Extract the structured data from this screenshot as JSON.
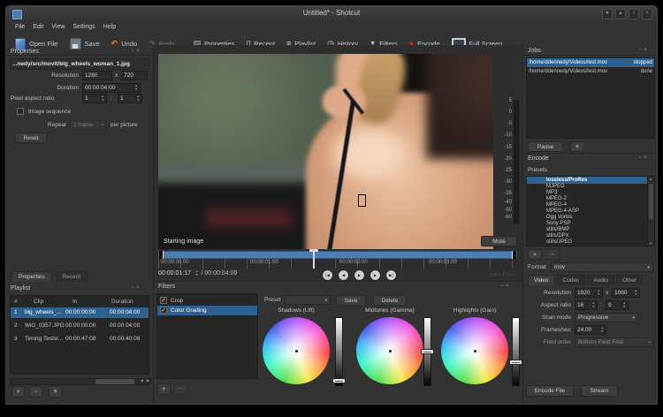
{
  "window": {
    "title": "Untitled* - Shotcut"
  },
  "icons": {
    "float": "▫",
    "close": "×",
    "spin_up": "▲",
    "spin_down": "▼",
    "combo": "▾",
    "check": "✓",
    "add": "+",
    "remove": "−",
    "menu": "≡",
    "undo": "↶",
    "redo": "↷",
    "record": "●",
    "history": "◷",
    "properties": "▤",
    "recent": "▯",
    "playlist": "≡",
    "funnel": "▼",
    "skip_back": "|◀",
    "step_back": "◀",
    "play": "▶",
    "step_fwd": "▶",
    "skip_fwd": "▶|",
    "left": "◀",
    "right": "▶",
    "up": "▲",
    "down": "▼",
    "win_shade": "▾",
    "win_min": "▴",
    "win_max": "▫",
    "win_close": "×"
  },
  "menu": {
    "items": [
      "File",
      "Edit",
      "View",
      "Settings",
      "Help"
    ]
  },
  "toolbar": {
    "open_file": "Open File",
    "save": "Save",
    "undo": "Undo",
    "redo": "Redo",
    "properties": "Properties",
    "recent": "Recent",
    "playlist": "Playlist",
    "history": "History",
    "filters": "Filters",
    "encode": "Encode",
    "full_screen": "Full Screen"
  },
  "properties_panel": {
    "title": "Properties",
    "filename": "...nedy/src/movit/blg_wheels_woman_1.jpg",
    "resolution_label": "Resolution",
    "resolution_w": "1280",
    "times": "x",
    "resolution_h": "720",
    "duration_label": "Duration",
    "duration": "00:00:04:00",
    "par_label": "Pixel aspect ratio",
    "par_num": "1",
    "colon": ":",
    "par_den": "1",
    "image_sequence_label": "Image sequence",
    "repeat_label": "Repeat",
    "repeat_value": "1 frame",
    "repeat_suffix": "per picture",
    "reset_label": "Reset"
  },
  "bottom_tabs": {
    "properties": "Properties",
    "recent": "Recent"
  },
  "playlist_panel": {
    "title": "Playlist",
    "columns": [
      "#",
      "Clip",
      "In",
      "Duration"
    ],
    "rows": [
      {
        "num": "1",
        "clip": "blg_wheels_...",
        "in": "00:00:00:00",
        "duration": "00:00:04:00"
      },
      {
        "num": "2",
        "clip": "IMG_0357.JPG",
        "in": "00:00:00:00",
        "duration": "00:00:04:00"
      },
      {
        "num": "3",
        "clip": "Timing TestsI...",
        "in": "00:00:47:08",
        "duration": "00:00:40:08"
      }
    ]
  },
  "player": {
    "caption": "Starting image",
    "mute_label": "Mute",
    "meter_ticks": [
      "5",
      "0",
      "-5",
      "-10",
      "-15",
      "-20",
      "-25",
      "-30",
      "-35",
      "-40",
      "-50",
      "-60"
    ],
    "ruler_ticks": [
      "00:00:00:00",
      "00:00:01:00",
      "00:00:02:00",
      "00:00:03:00"
    ],
    "position": "00:00:01:17",
    "total": "/ 00:00:04:00",
    "selection": "-:-:-:-  /  -:-:-:-"
  },
  "jobs_panel": {
    "title": "Jobs",
    "rows": [
      {
        "path": "/home/ddennedy/Videos/test.mov",
        "status": "stopped"
      },
      {
        "path": "/home/ddennedy/Videos/test.mov",
        "status": "done"
      }
    ],
    "pause_label": "Pause"
  },
  "encode_panel": {
    "title": "Encode",
    "presets_label": "Presets",
    "presets": [
      "lossless/ProRes",
      "MJPEG",
      "MP3",
      "MPEG-2",
      "MPEG-4",
      "MPEG-4-ASP",
      "Ogg Vorbis",
      "Sony-PSP",
      "stills/BMP",
      "stills/DPX",
      "stills/JPEG"
    ],
    "format_label": "Format",
    "format_value": "mov",
    "tabs": [
      "Video",
      "Codec",
      "Audio",
      "Other"
    ],
    "fields": {
      "resolution_label": "Resolution",
      "res_w": "1920",
      "times": "x",
      "res_h": "1080",
      "aspect_label": "Aspect ratio",
      "aspect_num": "16",
      "colon": ":",
      "aspect_den": "9",
      "scan_label": "Scan mode",
      "scan_value": "Progressive",
      "fps_label": "Frames/sec",
      "fps_value": "24.00",
      "field_label": "Field order",
      "field_value": "Bottom Field First"
    },
    "encode_file_label": "Encode File",
    "stream_label": "Stream"
  },
  "filters_panel": {
    "title": "Filters",
    "items": [
      {
        "label": "Crop"
      },
      {
        "label": "Color Grading"
      }
    ],
    "preset_label": "Preset",
    "save_label": "Save",
    "delete_label": "Delete",
    "wheels": [
      "Shadows (Lift)",
      "Midtones (Gamma)",
      "Highlights (Gain)"
    ]
  },
  "colors": {
    "selection": "#2d618f",
    "timeline_bar": "#4d7eb3",
    "add_green": "#55a555",
    "remove_red": "#b04a4a"
  }
}
